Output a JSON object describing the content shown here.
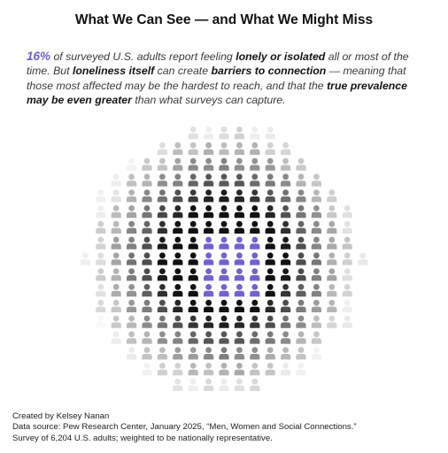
{
  "title": "What We Can See — and What We Might Miss",
  "intro": {
    "stat": "16%",
    "p1": " of surveyed U.S. adults report feeling ",
    "b1": "lonely or isolated",
    "p2": " all or most of the time. But ",
    "b2": "loneliness itself",
    "p3": " can create ",
    "b3": "barriers to connection",
    "p4": " — meaning that those most affected may be the hardest to reach, and that the ",
    "b4": "true prevalence may be even greater",
    "p5": " than what surveys can capture."
  },
  "chart_data": {
    "type": "pictogram",
    "unit": "person",
    "rows": 17,
    "cols": 19,
    "highlight_value_percent": 16,
    "highlight_block": {
      "rows": 4,
      "cols": 4
    },
    "grid": false,
    "colors": {
      "highlight": "#6f63d3",
      "base": "#111111",
      "fade_to": "#ffffff"
    }
  },
  "footer": {
    "line1": "Created by Kelsey Nanan",
    "line2": "Data source: Pew Research Center, January 2025, “Men, Women and Social Connections.”",
    "line3": "Survey of 6,204 U.S. adults; weighted to be nationally representative."
  }
}
